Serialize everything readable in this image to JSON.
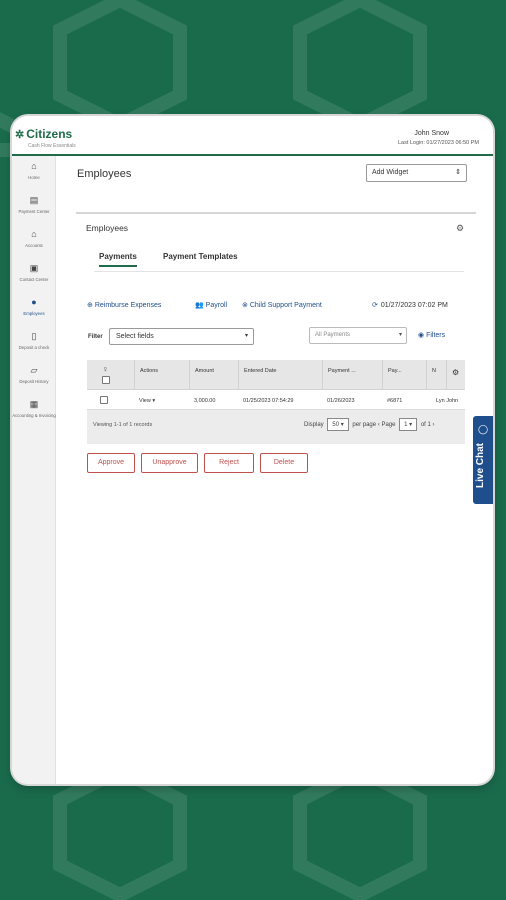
{
  "header": {
    "logo_text": "Citizens",
    "logo_sub": "Cash Flow Essentials",
    "user_name": "John Snow",
    "last_login": "Last Login: 01/27/2023 06:50 PM"
  },
  "sidebar": {
    "items": [
      {
        "label": "Home",
        "icon": "home-icon"
      },
      {
        "label": "Payment Center",
        "icon": "payment-icon"
      },
      {
        "label": "Accounts",
        "icon": "bank-icon"
      },
      {
        "label": "Contact Center",
        "icon": "contact-icon"
      },
      {
        "label": "Employees",
        "icon": "people-icon"
      },
      {
        "label": "Deposit a check",
        "icon": "phone-icon"
      },
      {
        "label": "Deposit History",
        "icon": "folder-icon"
      },
      {
        "label": "Accounting & Invoicing",
        "icon": "invoice-icon"
      }
    ]
  },
  "main": {
    "page_title": "Employees",
    "add_widget": "Add Widget",
    "widget_title": "Employees",
    "tabs": [
      "Payments",
      "Payment Templates"
    ],
    "actions": [
      "Reimburse Expenses",
      "Payroll",
      "Child Support Payment"
    ],
    "refresh_time": "01/27/2023 07:02 PM",
    "filter_label": "Filter",
    "filter_placeholder": "Select fields",
    "payments_select": "All Payments",
    "filters_link": "Filters"
  },
  "grid": {
    "columns": [
      "Actions",
      "Amount",
      "Entered Date",
      "Payment ...",
      "Pay...",
      "N"
    ],
    "rows": [
      {
        "action": "View",
        "amount": "3,000.00",
        "entered": "01/25/2023 07:54:29",
        "payment_date": "01/26/2023",
        "pay": "#6871",
        "name": "Lyn John"
      }
    ],
    "viewing": "Viewing 1-1 of 1 records",
    "display_label": "Display",
    "display_value": "50",
    "per_page": "per page",
    "page_label": "Page",
    "page_value": "1",
    "of_label": "of 1"
  },
  "buttons": [
    "Approve",
    "Unapprove",
    "Reject",
    "Delete"
  ],
  "live_chat": "Live Chat",
  "colors": {
    "brand_green": "#1f6b4a",
    "link_blue": "#1f4e8c",
    "danger": "#c0504d",
    "background": "#1a6b4c"
  }
}
